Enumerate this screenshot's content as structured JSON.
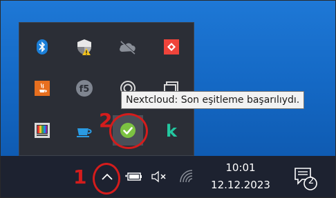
{
  "tooltip": {
    "text": "Nextcloud: Son eşitleme başarılıydı."
  },
  "flyout": {
    "icons": [
      {
        "name": "bluetooth-icon",
        "tooltip": ""
      },
      {
        "name": "windows-security-icon"
      },
      {
        "name": "onedrive-offline-icon"
      },
      {
        "name": "anydesk-icon"
      },
      {
        "name": "java-icon"
      },
      {
        "name": "f5-icon",
        "label": "f5"
      },
      {
        "name": "app-icon-circle"
      },
      {
        "name": "app-icon-window"
      },
      {
        "name": "color-palette-icon"
      },
      {
        "name": "coffee-cup-icon"
      },
      {
        "name": "nextcloud-icon"
      },
      {
        "name": "k-app-icon",
        "label": "k"
      }
    ]
  },
  "taskbar": {
    "show_hidden_icons": "chevron-up-icon",
    "battery_icon": "battery-icon",
    "volume_icon": "volume-muted-icon",
    "wifi_icon": "wifi-icon",
    "clock": {
      "time": "10:01",
      "date": "12.12.2023"
    },
    "notifications": {
      "icon": "notification-center-icon",
      "count": "2"
    }
  },
  "annotations": {
    "step1": "1",
    "step2": "2",
    "color": "#d41c1c"
  }
}
